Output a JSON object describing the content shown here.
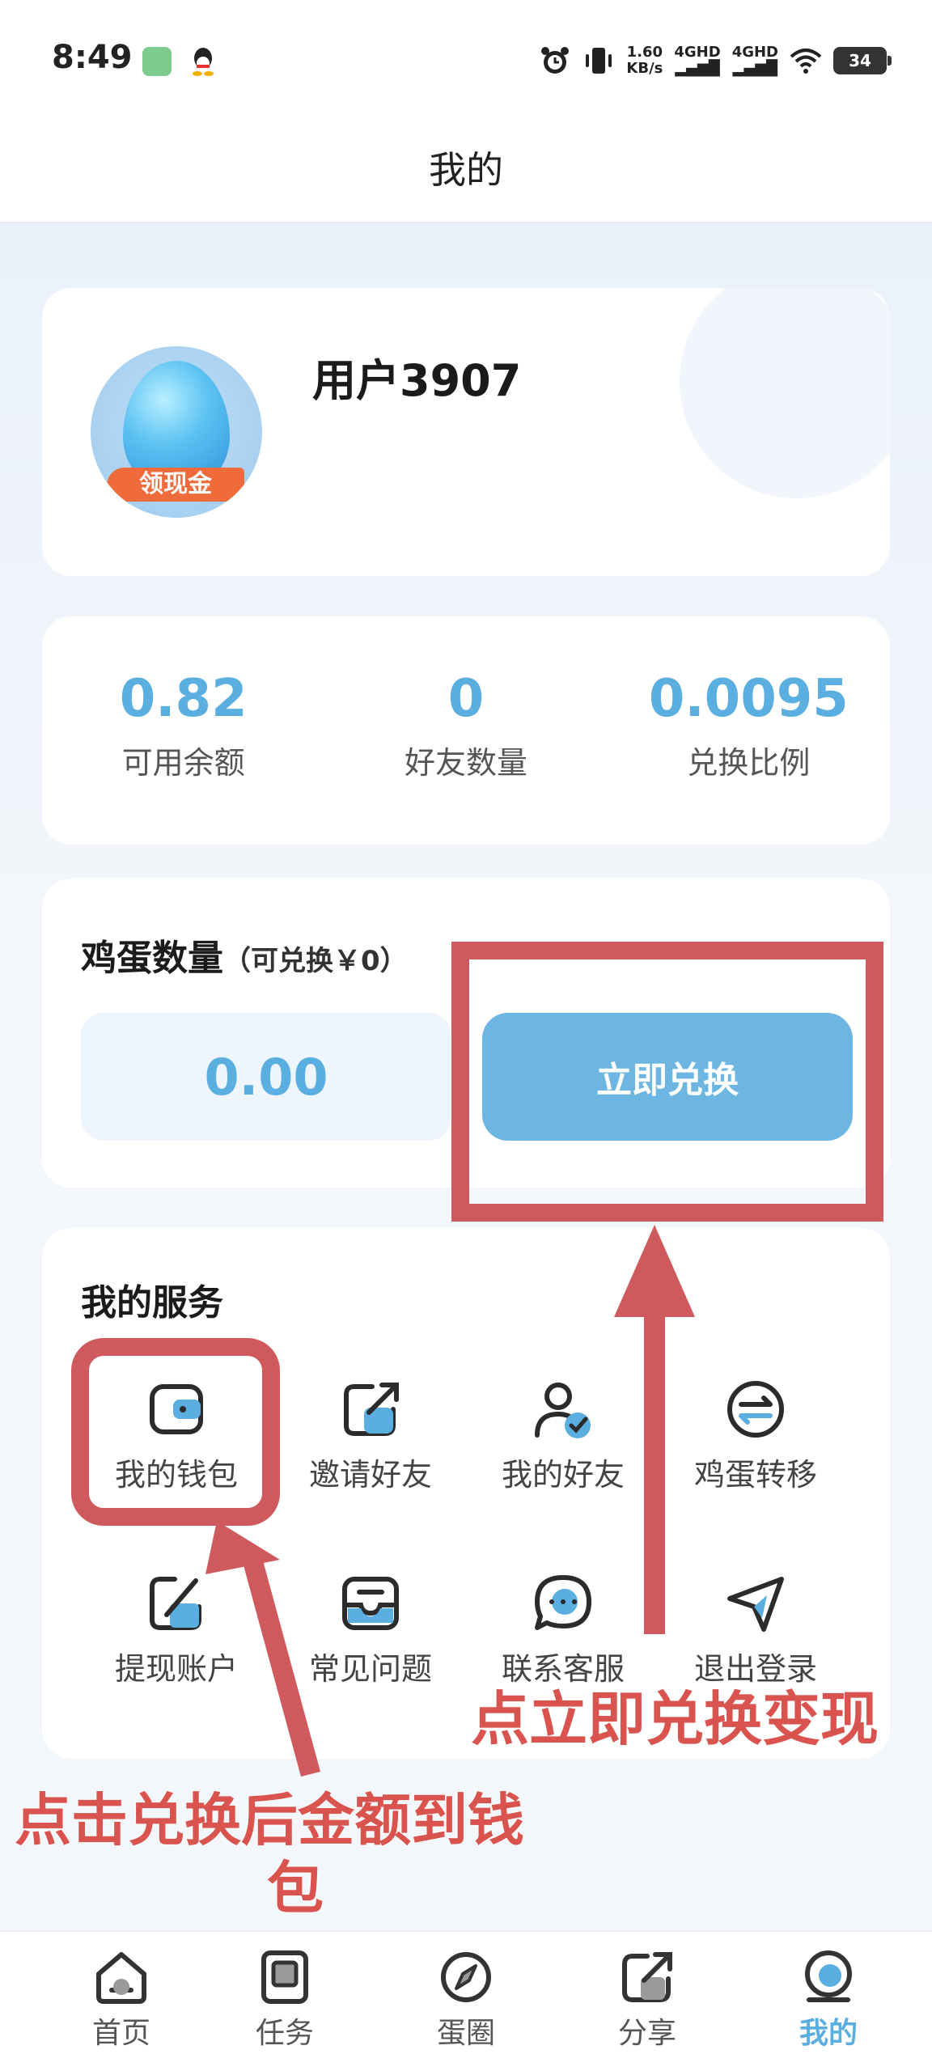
{
  "status_bar": {
    "time": "8:49",
    "network_speed_value": "1.60",
    "network_speed_unit": "KB/s",
    "signal_1": "4GHD",
    "signal_2": "4GHD",
    "battery": "34"
  },
  "header": {
    "title": "我的"
  },
  "profile": {
    "username": "用户3907",
    "avatar_badge": "领现金"
  },
  "stats": [
    {
      "value": "0.82",
      "label": "可用余额"
    },
    {
      "value": "0",
      "label": "好友数量"
    },
    {
      "value": "0.0095",
      "label": "兑换比例"
    }
  ],
  "egg": {
    "title": "鸡蛋数量",
    "subtitle": "（可兑换￥0）",
    "amount": "0.00",
    "exchange_label": "立即兑换"
  },
  "services": {
    "title": "我的服务",
    "items": [
      {
        "label": "我的钱包",
        "icon": "wallet-icon"
      },
      {
        "label": "邀请好友",
        "icon": "share-icon"
      },
      {
        "label": "我的好友",
        "icon": "friends-icon"
      },
      {
        "label": "鸡蛋转移",
        "icon": "transfer-icon"
      },
      {
        "label": "提现账户",
        "icon": "edit-icon"
      },
      {
        "label": "常见问题",
        "icon": "inbox-icon"
      },
      {
        "label": "联系客服",
        "icon": "chat-icon"
      },
      {
        "label": "退出登录",
        "icon": "send-icon"
      }
    ]
  },
  "annotations": {
    "exchange_hint": "点立即兑换变现",
    "wallet_hint_line1": "点击兑换后金额到钱",
    "wallet_hint_line2": "包"
  },
  "bottom_nav": [
    {
      "label": "首页",
      "icon": "home-icon",
      "active": false
    },
    {
      "label": "任务",
      "icon": "task-icon",
      "active": false
    },
    {
      "label": "蛋圈",
      "icon": "compass-icon",
      "active": false
    },
    {
      "label": "分享",
      "icon": "share-icon",
      "active": false
    },
    {
      "label": "我的",
      "icon": "profile-icon",
      "active": true
    }
  ],
  "colors": {
    "accent": "#5aaee0",
    "button": "#6db6e2",
    "annotation_red": "#cf5a5e"
  }
}
